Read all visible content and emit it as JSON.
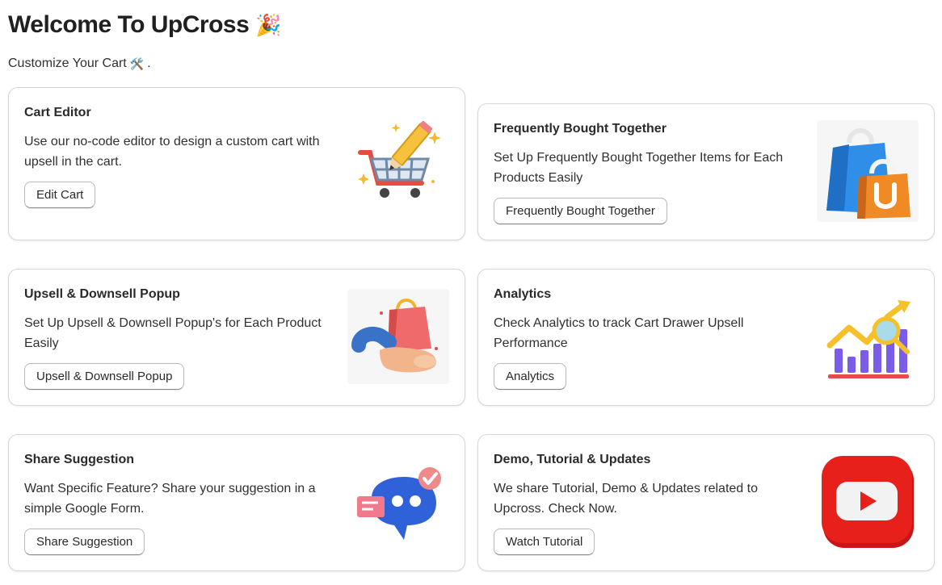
{
  "header": {
    "title": "Welcome To UpCross",
    "title_emoji": "🎉",
    "subtitle": "Customize Your Cart",
    "subtitle_emoji": "🛠️",
    "subtitle_suffix": "."
  },
  "cards": [
    {
      "title": "Cart Editor",
      "description": "Use our no-code editor to design a custom cart with upsell in the cart.",
      "button_label": "Edit Cart",
      "icon": "shopping-cart-pencil-icon"
    },
    {
      "title": "Frequently Bought Together",
      "description": "Set Up Frequently Bought Together Items for Each Products Easily",
      "button_label": "Frequently Bought Together",
      "icon": "shopping-bags-icon"
    },
    {
      "title": "Upsell & Downsell Popup",
      "description": "Set Up Upsell & Downsell Popup's for Each Product Easily",
      "button_label": "Upsell & Downsell Popup",
      "icon": "hand-holding-bag-icon"
    },
    {
      "title": "Analytics",
      "description": "Check Analytics to track Cart Drawer Upsell Performance",
      "button_label": "Analytics",
      "icon": "analytics-chart-icon"
    },
    {
      "title": "Share Suggestion",
      "description": "Want Specific Feature? Share your suggestion in a simple Google Form.",
      "button_label": "Share Suggestion",
      "icon": "chat-bubble-icon"
    },
    {
      "title": "Demo, Tutorial & Updates",
      "description": "We share Tutorial, Demo & Updates related to Upcross. Check Now.",
      "button_label": "Watch Tutorial",
      "icon": "youtube-play-icon"
    }
  ],
  "colors": {
    "card_border": "#d7d7d7",
    "text": "#303030",
    "youtube_red": "#e8201c",
    "bag_blue": "#2f8fe8",
    "bag_orange": "#f08a24"
  }
}
